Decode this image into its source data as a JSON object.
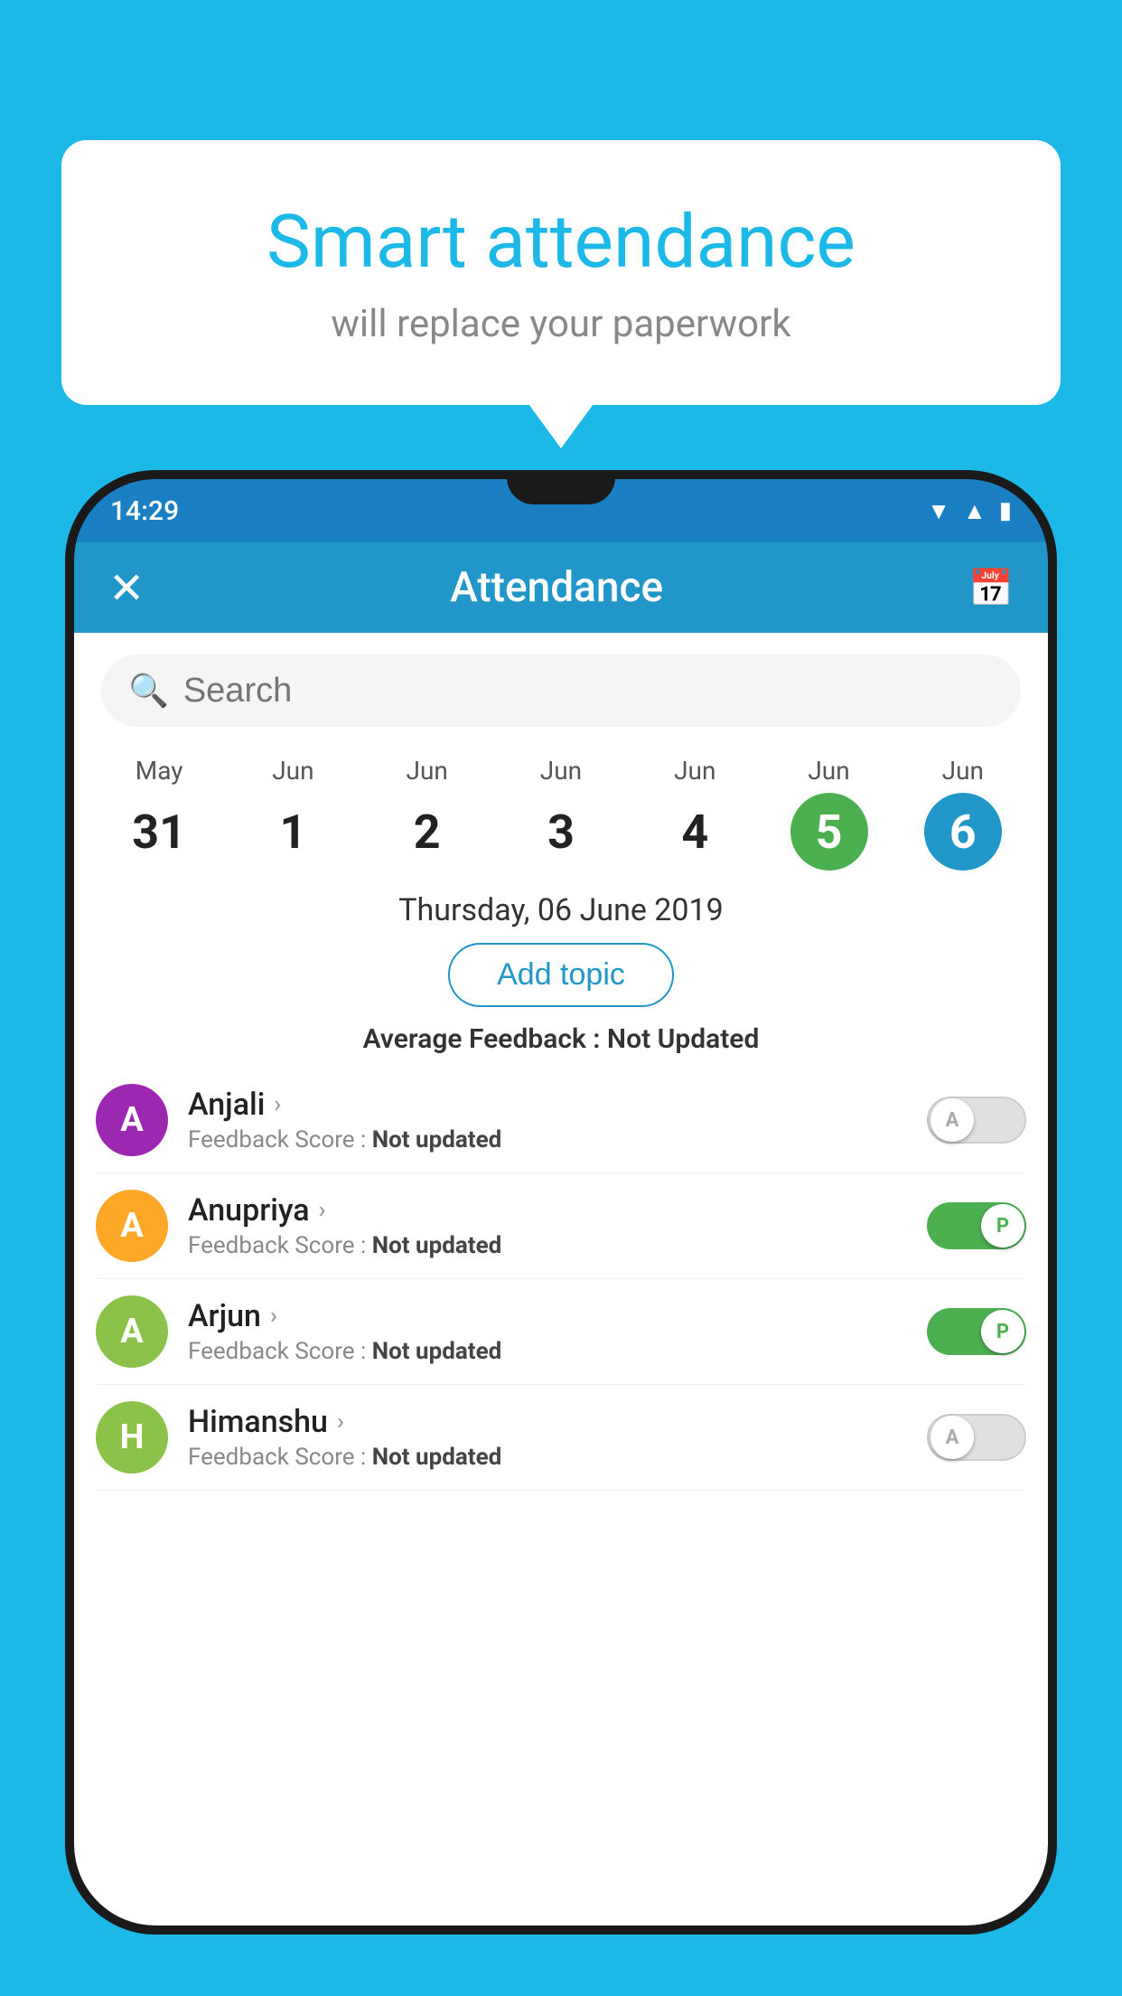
{
  "background_color": "#1BB8E8",
  "speech_bubble": {
    "title": "Smart attendance",
    "subtitle": "will replace your paperwork"
  },
  "status_bar": {
    "time": "14:29",
    "icons": [
      "wifi",
      "signal",
      "battery"
    ]
  },
  "header": {
    "close_label": "✕",
    "title": "Attendance",
    "calendar_icon": "📅"
  },
  "search": {
    "placeholder": "Search"
  },
  "dates": [
    {
      "month": "May",
      "day": "31",
      "state": "normal"
    },
    {
      "month": "Jun",
      "day": "1",
      "state": "normal"
    },
    {
      "month": "Jun",
      "day": "2",
      "state": "normal"
    },
    {
      "month": "Jun",
      "day": "3",
      "state": "normal"
    },
    {
      "month": "Jun",
      "day": "4",
      "state": "normal"
    },
    {
      "month": "Jun",
      "day": "5",
      "state": "today"
    },
    {
      "month": "Jun",
      "day": "6",
      "state": "selected"
    }
  ],
  "selected_date_label": "Thursday, 06 June 2019",
  "add_topic_label": "Add topic",
  "avg_feedback_prefix": "Average Feedback : ",
  "avg_feedback_value": "Not Updated",
  "students": [
    {
      "name": "Anjali",
      "initial": "A",
      "avatar_color": "#9C27B0",
      "feedback_label": "Feedback Score : ",
      "feedback_value": "Not updated",
      "toggle_state": "off",
      "toggle_letter": "A"
    },
    {
      "name": "Anupriya",
      "initial": "A",
      "avatar_color": "#FFA726",
      "feedback_label": "Feedback Score : ",
      "feedback_value": "Not updated",
      "toggle_state": "on",
      "toggle_letter": "P"
    },
    {
      "name": "Arjun",
      "initial": "A",
      "avatar_color": "#8BC34A",
      "feedback_label": "Feedback Score : ",
      "feedback_value": "Not updated",
      "toggle_state": "on",
      "toggle_letter": "P"
    },
    {
      "name": "Himanshu",
      "initial": "H",
      "avatar_color": "#8BC34A",
      "feedback_label": "Feedback Score : ",
      "feedback_value": "Not updated",
      "toggle_state": "off",
      "toggle_letter": "A"
    }
  ]
}
